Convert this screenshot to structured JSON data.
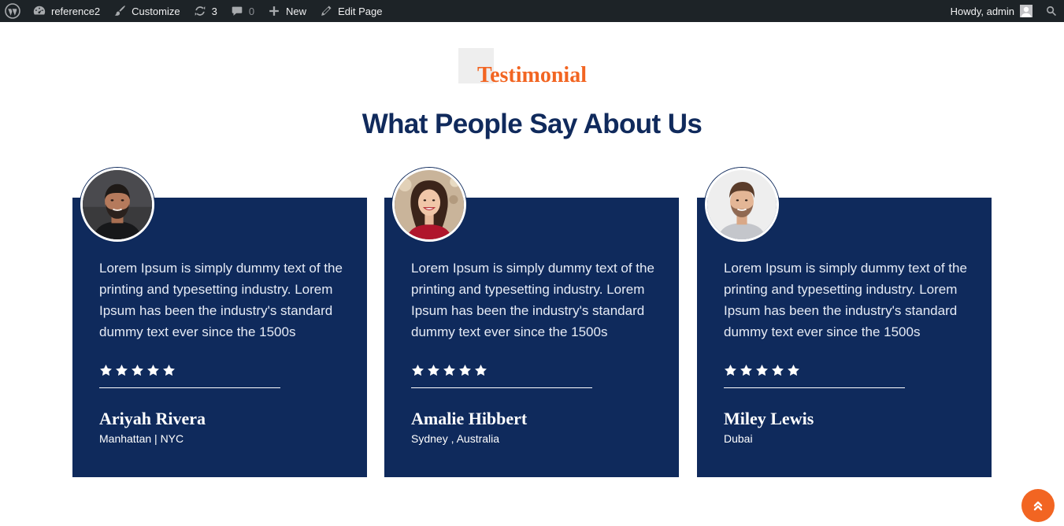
{
  "adminbar": {
    "site_name": "reference2",
    "customize_label": "Customize",
    "updates_count": "3",
    "comments_count": "0",
    "new_label": "New",
    "edit_page_label": "Edit Page",
    "howdy_label": "Howdy, admin",
    "icons": [
      "wordpress-logo-icon",
      "dashboard-icon",
      "brush-icon",
      "updates-icon",
      "comment-icon",
      "plus-icon",
      "pencil-icon",
      "user-avatar-icon",
      "search-icon"
    ]
  },
  "section": {
    "subtitle": "Testimonial",
    "title": "What People Say About Us"
  },
  "testimonials": [
    {
      "text": "Lorem Ipsum is simply dummy text of the printing and typesetting industry. Lorem Ipsum has been the industry's standard dummy text ever since the 1500s",
      "rating": 5,
      "name": "Ariyah Rivera",
      "location": "Manhattan | NYC"
    },
    {
      "text": "Lorem Ipsum is simply dummy text of the printing and typesetting industry. Lorem Ipsum has been the industry's standard dummy text ever since the 1500s",
      "rating": 5,
      "name": "Amalie Hibbert",
      "location": "Sydney , Australia"
    },
    {
      "text": "Lorem Ipsum is simply dummy text of the printing and typesetting industry. Lorem Ipsum has been the industry's standard dummy text ever since the 1500s",
      "rating": 5,
      "name": "Miley Lewis",
      "location": "Dubai"
    }
  ],
  "colors": {
    "adminbar_bg": "#1d2327",
    "accent_orange": "#f26522",
    "navy": "#0f2a5c",
    "heading_navy": "#102a5c"
  }
}
